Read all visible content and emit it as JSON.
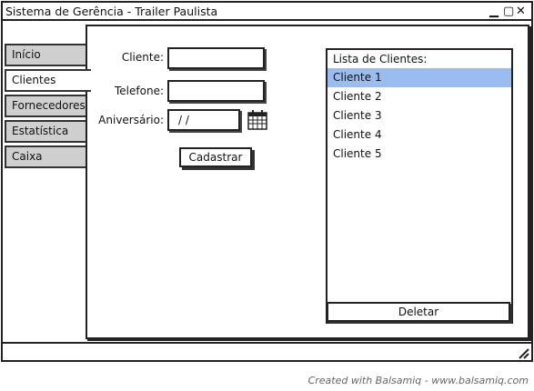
{
  "window": {
    "title": "Sistema de Gerência - Trailer Paulista",
    "controls": [
      "▁",
      "▢",
      "✕"
    ]
  },
  "tabs": [
    {
      "label": "Início",
      "active": false
    },
    {
      "label": "Clientes",
      "active": true
    },
    {
      "label": "Fornecedores",
      "active": false
    },
    {
      "label": "Estatística",
      "active": false
    },
    {
      "label": "Caixa",
      "active": false
    }
  ],
  "form": {
    "cliente_label": "Cliente:",
    "cliente_value": "",
    "telefone_label": "Telefone:",
    "telefone_value": "",
    "aniversario_label": "Aniversário:",
    "aniversario_value": "/ /",
    "submit_label": "Cadastrar"
  },
  "client_list": {
    "header": "Lista de Clientes:",
    "items": [
      "Cliente 1",
      "Cliente 2",
      "Cliente 3",
      "Cliente 4",
      "Cliente 5"
    ],
    "selected_index": 0,
    "delete_label": "Deletar"
  },
  "footer": {
    "credit": "Created with Balsamiq - www.balsamiq.com"
  },
  "colors": {
    "selection": "#9bbcef",
    "inactive_tab": "#cfcfcf"
  },
  "icons": {
    "calendar": "calendar-icon",
    "resize_grip": "resize-grip-icon"
  }
}
